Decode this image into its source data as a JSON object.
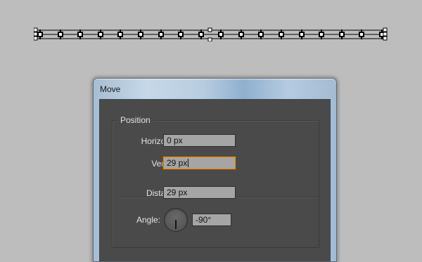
{
  "dialog": {
    "title": "Move"
  },
  "position_group": {
    "legend": "Position",
    "horizontal": {
      "label": "Horizontal:",
      "value": "0 px"
    },
    "vertical": {
      "label": "Vertical:",
      "value": "29 px"
    },
    "distance": {
      "label": "Distance:",
      "value": "29 px"
    },
    "angle": {
      "label": "Angle:",
      "value": "-90°",
      "dial_degrees": -90
    }
  },
  "artwork": {
    "anchor_count": 18,
    "selection_color": "#000000",
    "selection_box_color": "#ffffff"
  },
  "colors": {
    "canvas": "#bdbdbd",
    "panel": "#4a4a4a",
    "field": "#a5a5a5",
    "focus": "#e28a16"
  }
}
